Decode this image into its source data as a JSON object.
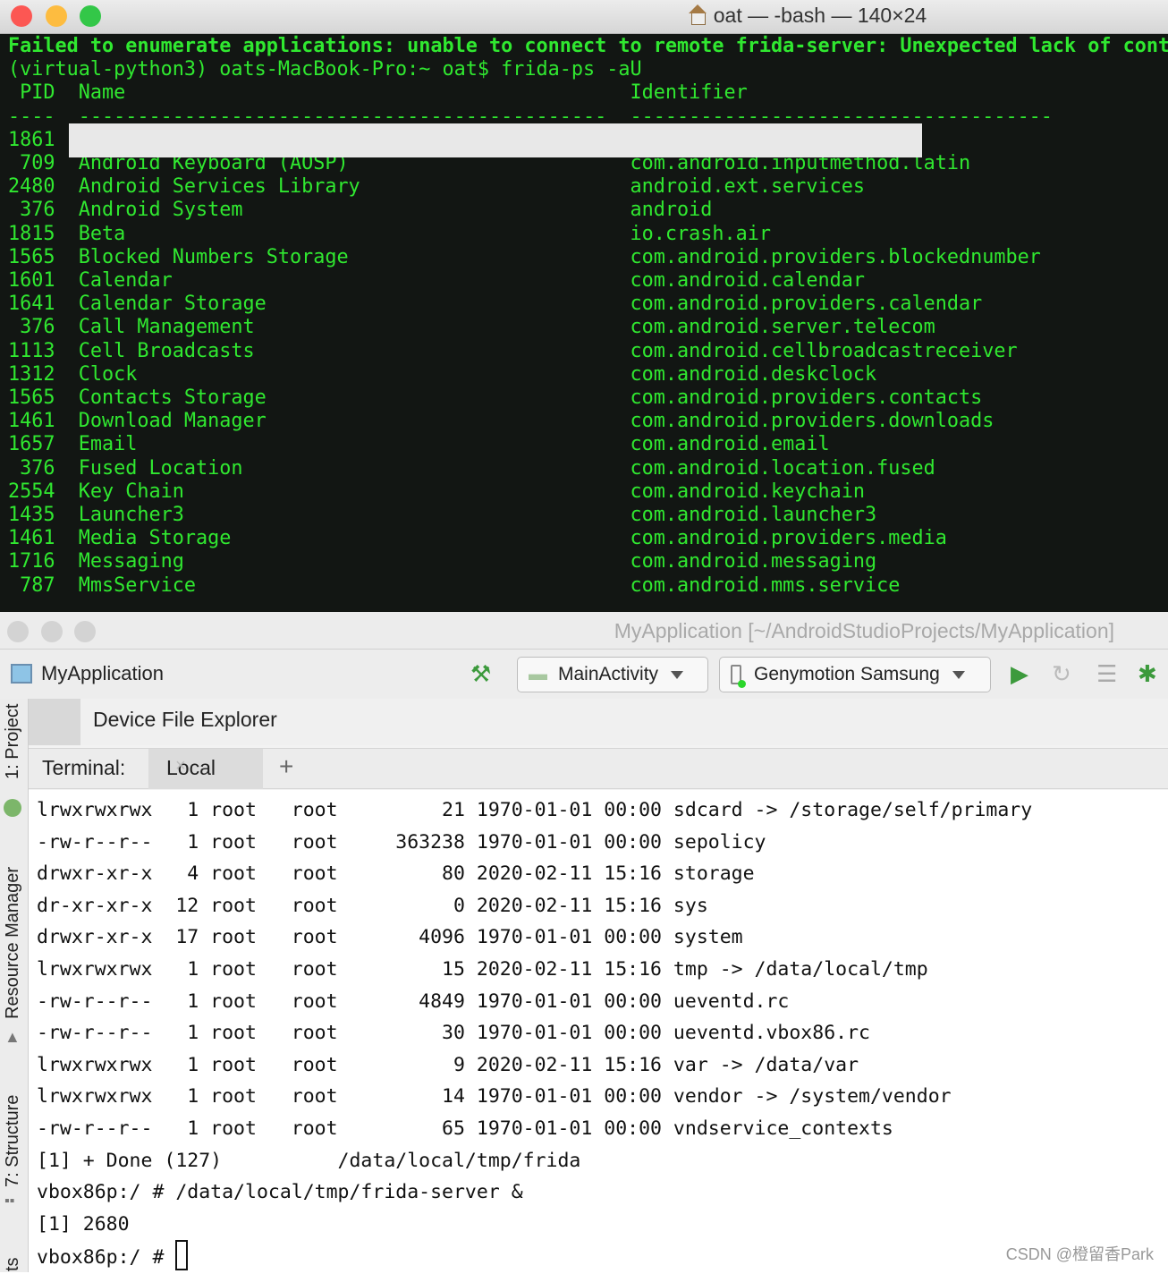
{
  "mac_terminal": {
    "title": "oat — -bash — 140×24",
    "error_line": "Failed to enumerate applications: unable to connect to remote frida-server: Unexpected lack of cont",
    "prompt": "(virtual-python3) oats-MacBook-Pro:~ oat$ frida-ps -aU",
    "headers": {
      "pid": "PID",
      "name": "Name",
      "identifier": "Identifier"
    },
    "first_pid": "1861",
    "rows": [
      {
        "pid": "709",
        "name": "Android Keyboard (AOSP)",
        "identifier": "com.android.inputmethod.latin"
      },
      {
        "pid": "2480",
        "name": "Android Services Library",
        "identifier": "android.ext.services"
      },
      {
        "pid": "376",
        "name": "Android System",
        "identifier": "android"
      },
      {
        "pid": "1815",
        "name": "Beta",
        "identifier": "io.crash.air"
      },
      {
        "pid": "1565",
        "name": "Blocked Numbers Storage",
        "identifier": "com.android.providers.blockednumber"
      },
      {
        "pid": "1601",
        "name": "Calendar",
        "identifier": "com.android.calendar"
      },
      {
        "pid": "1641",
        "name": "Calendar Storage",
        "identifier": "com.android.providers.calendar"
      },
      {
        "pid": "376",
        "name": "Call Management",
        "identifier": "com.android.server.telecom"
      },
      {
        "pid": "1113",
        "name": "Cell Broadcasts",
        "identifier": "com.android.cellbroadcastreceiver"
      },
      {
        "pid": "1312",
        "name": "Clock",
        "identifier": "com.android.deskclock"
      },
      {
        "pid": "1565",
        "name": "Contacts Storage",
        "identifier": "com.android.providers.contacts"
      },
      {
        "pid": "1461",
        "name": "Download Manager",
        "identifier": "com.android.providers.downloads"
      },
      {
        "pid": "1657",
        "name": "Email",
        "identifier": "com.android.email"
      },
      {
        "pid": "376",
        "name": "Fused Location",
        "identifier": "com.android.location.fused"
      },
      {
        "pid": "2554",
        "name": "Key Chain",
        "identifier": "com.android.keychain"
      },
      {
        "pid": "1435",
        "name": "Launcher3",
        "identifier": "com.android.launcher3"
      },
      {
        "pid": "1461",
        "name": "Media Storage",
        "identifier": "com.android.providers.media"
      },
      {
        "pid": "1716",
        "name": "Messaging",
        "identifier": "com.android.messaging"
      },
      {
        "pid": "787",
        "name": "MmsService",
        "identifier": "com.android.mms.service"
      }
    ]
  },
  "studio": {
    "title": "MyApplication [~/AndroidStudioProjects/MyApplication]",
    "project": "MyApplication",
    "run_config": "MainActivity",
    "device": "Genymotion Samsung",
    "panel_title": "Device File Explorer",
    "terminal_label": "Terminal:",
    "tab_local": "Local",
    "side_tabs": [
      "1: Project",
      "Resource Manager",
      "7: Structure",
      "ts"
    ],
    "files": [
      [
        "lrwxrwxrwx",
        "1",
        "root",
        "root",
        "21",
        "1970-01-01",
        "00:00",
        "sdcard -> /storage/self/primary"
      ],
      [
        "-rw-r--r--",
        "1",
        "root",
        "root",
        "363238",
        "1970-01-01",
        "00:00",
        "sepolicy"
      ],
      [
        "drwxr-xr-x",
        "4",
        "root",
        "root",
        "80",
        "2020-02-11",
        "15:16",
        "storage"
      ],
      [
        "dr-xr-xr-x",
        "12",
        "root",
        "root",
        "0",
        "2020-02-11",
        "15:16",
        "sys"
      ],
      [
        "drwxr-xr-x",
        "17",
        "root",
        "root",
        "4096",
        "1970-01-01",
        "00:00",
        "system"
      ],
      [
        "lrwxrwxrwx",
        "1",
        "root",
        "root",
        "15",
        "2020-02-11",
        "15:16",
        "tmp -> /data/local/tmp"
      ],
      [
        "-rw-r--r--",
        "1",
        "root",
        "root",
        "4849",
        "1970-01-01",
        "00:00",
        "ueventd.rc"
      ],
      [
        "-rw-r--r--",
        "1",
        "root",
        "root",
        "30",
        "1970-01-01",
        "00:00",
        "ueventd.vbox86.rc"
      ],
      [
        "lrwxrwxrwx",
        "1",
        "root",
        "root",
        "9",
        "2020-02-11",
        "15:16",
        "var -> /data/var"
      ],
      [
        "lrwxrwxrwx",
        "1",
        "root",
        "root",
        "14",
        "1970-01-01",
        "00:00",
        "vendor -> /system/vendor"
      ],
      [
        "-rw-r--r--",
        "1",
        "root",
        "root",
        "65",
        "1970-01-01",
        "00:00",
        "vndservice_contexts"
      ]
    ],
    "tail": [
      "[1] + Done (127)          /data/local/tmp/frida",
      "vbox86p:/ # /data/local/tmp/frida-server &",
      "[1] 2680"
    ],
    "prompt": "vbox86p:/ # "
  },
  "watermark": "CSDN @橙留香Park",
  "colors": {
    "terminal_text": "#30e830",
    "terminal_bg": "#121613",
    "run_green": "#3c9a3c"
  }
}
